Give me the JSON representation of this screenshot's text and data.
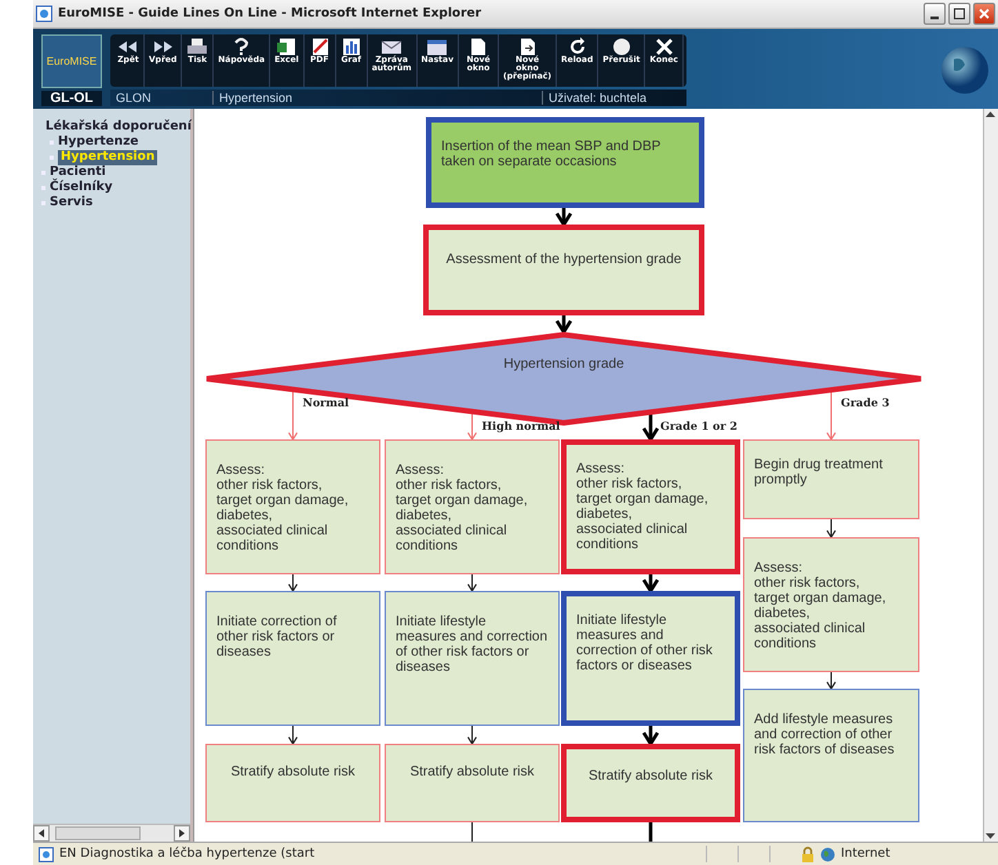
{
  "window": {
    "title": "EuroMISE - Guide Lines On Line - Microsoft Internet Explorer"
  },
  "toolbar": {
    "logo": "EuroMISE",
    "logo_caption": "GL-OL",
    "buttons": [
      {
        "label": "Zpět"
      },
      {
        "label": "Vpřed"
      },
      {
        "label": "Tisk"
      },
      {
        "label": "Nápověda"
      },
      {
        "label": "Excel"
      },
      {
        "label": "PDF"
      },
      {
        "label": "Graf"
      },
      {
        "label": "Zpráva autorům"
      },
      {
        "label": "Nastav"
      },
      {
        "label": "Nové okno"
      },
      {
        "label": "Nové okno (přepínač)"
      },
      {
        "label": "Reload"
      },
      {
        "label": "Přerušit"
      },
      {
        "label": "Konec"
      }
    ],
    "info": {
      "module": "GLON",
      "topic": "Hypertension",
      "user": "Uživatel: buchtela"
    }
  },
  "sidebar": {
    "items": [
      {
        "label": "Lékařská doporučení",
        "selected": false,
        "children": [
          {
            "label": "Hypertenze",
            "selected": false
          },
          {
            "label": "Hypertension",
            "selected": true
          }
        ]
      },
      {
        "label": "Pacienti",
        "selected": false
      },
      {
        "label": "Číselníky",
        "selected": false
      },
      {
        "label": "Servis",
        "selected": false
      }
    ]
  },
  "flowchart": {
    "nodes": [
      {
        "kind": "box",
        "text": "Insertion of the mean SBP and DBP taken on separate occasions",
        "highlighted": true
      },
      {
        "kind": "box",
        "text": "Assessment of the hypertension grade",
        "highlighted": true
      },
      {
        "kind": "diamond",
        "text": "Hypertension grade",
        "highlighted": true
      },
      {
        "kind": "box",
        "text": "Assess:\nother risk factors,\ntarget organ damage,\ndiabetes,\nassociated clinical\nconditions",
        "highlighted": false,
        "branch_label": "Normal"
      },
      {
        "kind": "box",
        "text": "Assess:\nother risk factors,\ntarget organ damage,\ndiabetes,\nassociated clinical\nconditions",
        "highlighted": false,
        "branch_label": "High normal"
      },
      {
        "kind": "box",
        "text": "Assess:\nother risk factors,\ntarget organ damage,\ndiabetes,\nassociated clinical\nconditions",
        "highlighted": true,
        "branch_label": "Grade 1 or 2"
      },
      {
        "kind": "box",
        "text": "Begin drug treatment promptly",
        "highlighted": false,
        "branch_label": "Grade 3"
      },
      {
        "kind": "box",
        "text": "Assess:\nother risk factors,\ntarget organ damage,\ndiabetes,\nassociated clinical\nconditions",
        "highlighted": false
      },
      {
        "kind": "box",
        "text": "Initiate correction of other risk factors or diseases",
        "highlighted": false
      },
      {
        "kind": "box",
        "text": "Initiate lifestyle measures and correction of other risk factors or diseases",
        "highlighted": false
      },
      {
        "kind": "box",
        "text": "Initiate lifestyle measures and correction of other risk factors or diseases",
        "highlighted": true
      },
      {
        "kind": "box",
        "text": "Add lifestyle measures and correction of other risk factors of diseases",
        "highlighted": false
      },
      {
        "kind": "box",
        "text": "Stratify absolute risk",
        "highlighted": false
      },
      {
        "kind": "box",
        "text": "Stratify absolute risk",
        "highlighted": false
      },
      {
        "kind": "box",
        "text": "Stratify absolute risk",
        "highlighted": true
      }
    ]
  },
  "status_bar": {
    "text": "EN Diagnostika a léčba hypertenze (start",
    "zone": "Internet"
  }
}
